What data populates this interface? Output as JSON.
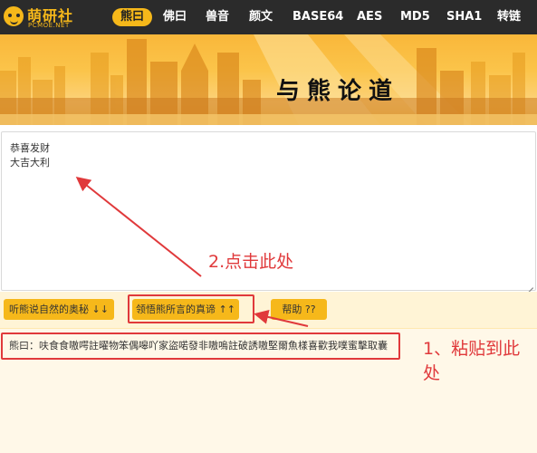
{
  "logo": {
    "title": "萌研社",
    "subtitle": "PCMOE.NET"
  },
  "nav": {
    "items": [
      {
        "label": "熊曰",
        "active": true
      },
      {
        "label": "佛曰",
        "active": false
      },
      {
        "label": "兽音",
        "active": false
      },
      {
        "label": "颜文",
        "active": false
      },
      {
        "label": "BASE64",
        "active": false
      },
      {
        "label": "AES",
        "active": false
      },
      {
        "label": "MD5",
        "active": false
      },
      {
        "label": "SHA1",
        "active": false
      },
      {
        "label": "转链",
        "active": false
      }
    ]
  },
  "banner": {
    "title": "与熊论道"
  },
  "input": {
    "lines": [
      "恭喜发财",
      "大吉大利"
    ]
  },
  "buttons": {
    "encode": "听熊说自然的奥秘 ↓↓",
    "decode": "领悟熊所言的真谛 ↑↑",
    "help": "帮助 ??"
  },
  "output": {
    "text": "熊曰：呋食食嗷㗁註曜物笨偶嗥吖家盜喏發非嗷嗚註破誘嗷堅爾魚樣喜歡我噗蜜擊取囊"
  },
  "annotations": {
    "click_hint": "2.点击此处",
    "paste_hint_line1": "1、粘贴到此",
    "paste_hint_line2": "处"
  },
  "colors": {
    "accent": "#f6b81a",
    "nav_bg": "#2b2b2b",
    "annotation": "#e0393b"
  }
}
